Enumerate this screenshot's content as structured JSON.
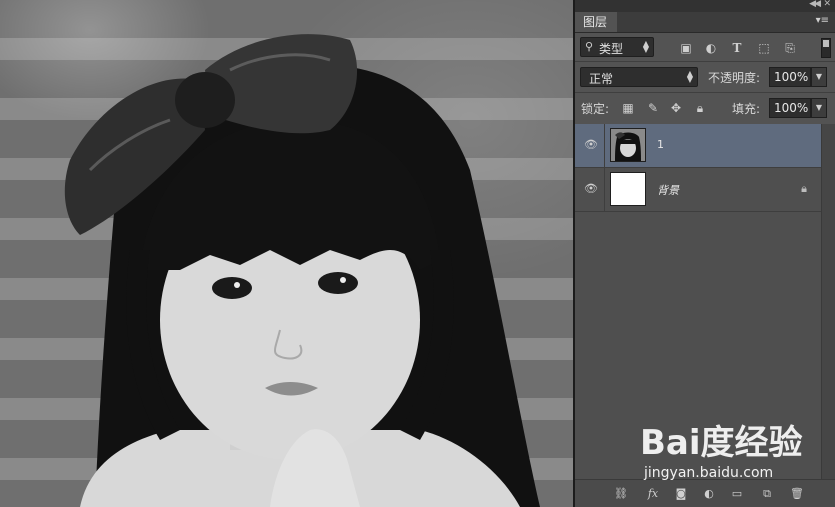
{
  "panel": {
    "tab_label": "图层",
    "filter": {
      "selected": "类型"
    },
    "blend_mode": "正常",
    "opacity_label": "不透明度:",
    "opacity_value": "100%",
    "lock_label": "锁定:",
    "fill_label": "填充:",
    "fill_value": "100%",
    "layers": [
      {
        "name": "1",
        "selected": true,
        "thumbnail": "photo"
      },
      {
        "name": "背景",
        "selected": false,
        "thumbnail": "white",
        "locked": true
      }
    ]
  },
  "icons": {
    "filter": [
      "image-filter-icon",
      "adjustment-filter-icon",
      "type-filter-icon",
      "shape-filter-icon",
      "smart-object-filter-icon"
    ],
    "lock": [
      "lock-transparent-icon",
      "lock-image-icon",
      "lock-position-icon",
      "lock-all-icon"
    ],
    "bottom": [
      "link-layers-icon",
      "layer-style-icon",
      "add-mask-icon",
      "adjustment-layer-icon",
      "new-group-icon",
      "new-layer-icon",
      "delete-layer-icon"
    ]
  },
  "watermark": {
    "brand": "Bai度经验",
    "url": "jingyan.baidu.com"
  },
  "colors": {
    "panel_bg": "#535353",
    "selected_layer": "#5f6b7e",
    "canvas_divider": "#1c1c1c"
  }
}
